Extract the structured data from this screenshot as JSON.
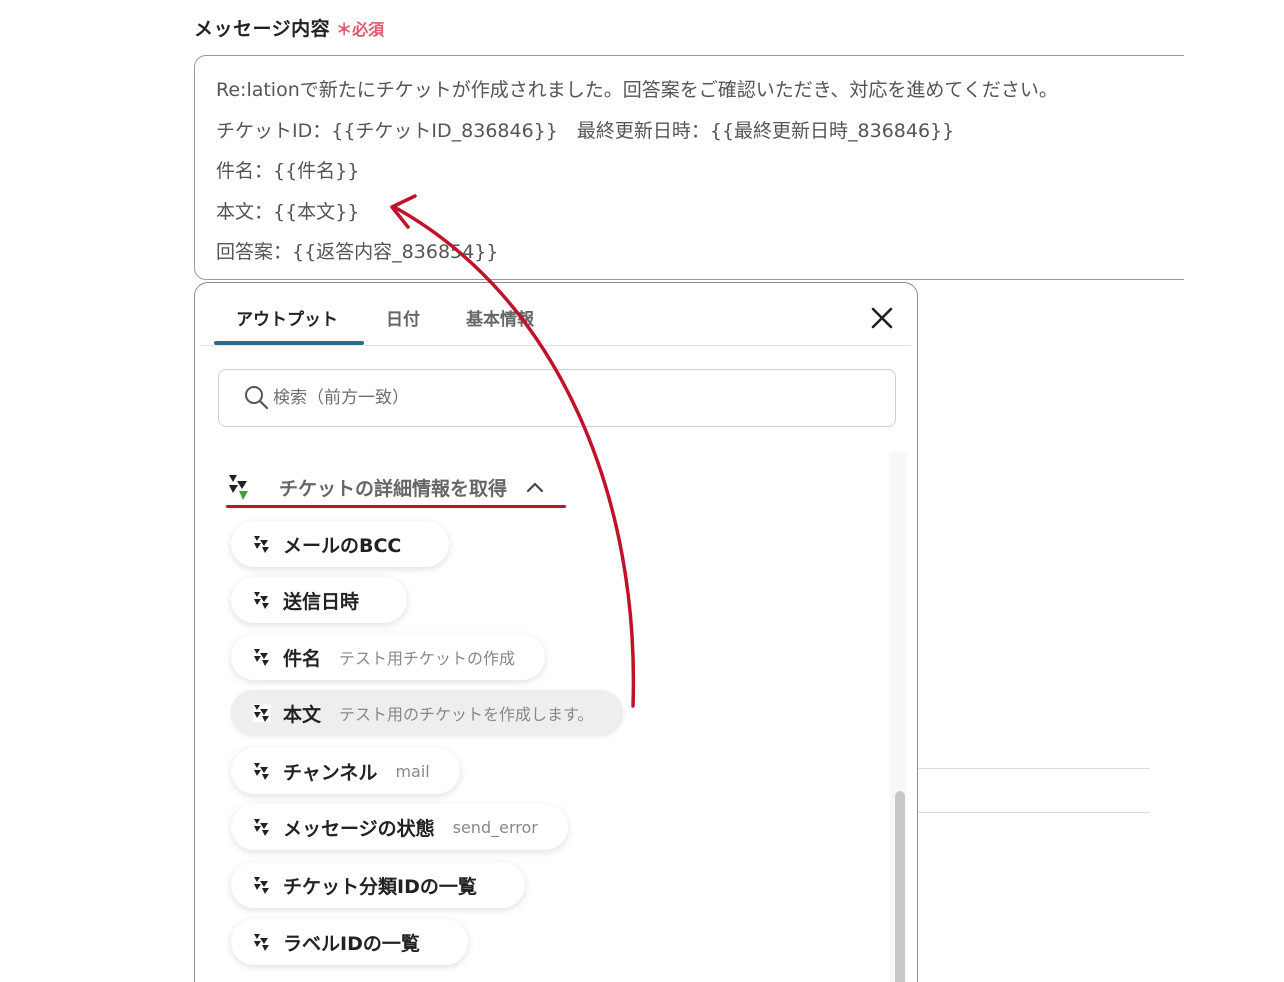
{
  "field": {
    "title": "メッセージ内容",
    "required_mark": "＊",
    "required_text": "必須"
  },
  "message_lines": [
    "Re:lationで新たにチケットが作成されました。回答案をご確認いただき、対応を進めてください。",
    "チケットID：{{チケットID_836846}}　最終更新日時：{{最終更新日時_836846}}",
    "件名：{{件名}}",
    "本文：{{本文}}",
    "回答案：{{返答内容_836854}}"
  ],
  "panel": {
    "tabs": [
      "アウトプット",
      "日付",
      "基本情報"
    ],
    "close_icon": "close-icon",
    "search_placeholder": "検索（前方一致）",
    "group": {
      "label": "チケットの詳細情報を取得",
      "expanded": true
    },
    "items": [
      {
        "name": "メールのBCC",
        "value": ""
      },
      {
        "name": "送信日時",
        "value": ""
      },
      {
        "name": "件名",
        "value": "テスト用チケットの作成"
      },
      {
        "name": "本文",
        "value": "テスト用のチケットを作成します。",
        "active": true
      },
      {
        "name": "チャンネル",
        "value": "mail"
      },
      {
        "name": "メッセージの状態",
        "value": "send_error"
      },
      {
        "name": "チケット分類IDの一覧",
        "value": ""
      },
      {
        "name": "ラベルIDの一覧",
        "value": ""
      }
    ]
  },
  "colors": {
    "accent_tab": "#2b6f86",
    "annotation_red": "#c0122a",
    "required": "#e0566b"
  }
}
